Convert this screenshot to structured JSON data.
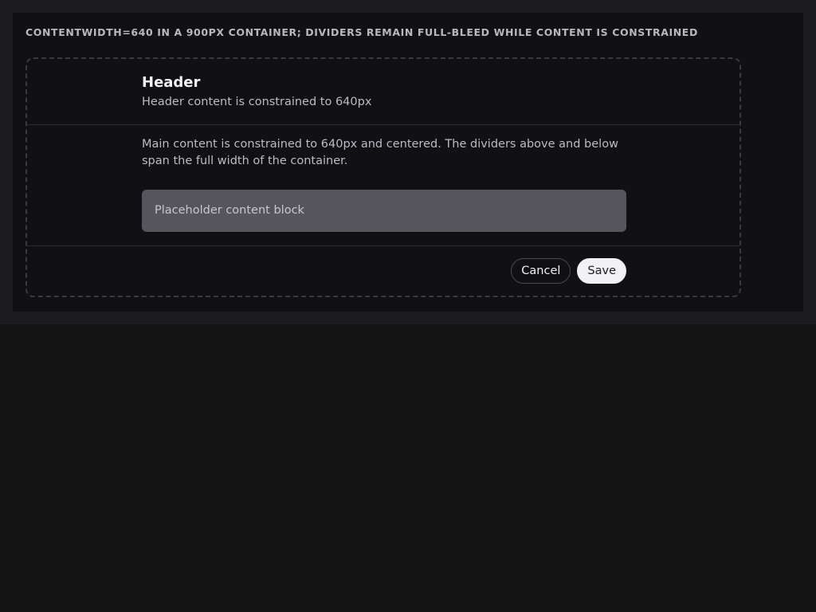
{
  "caption": "CONTENTWIDTH=640 IN A 900PX CONTAINER; DIVIDERS REMAIN FULL-BLEED WHILE CONTENT IS CONSTRAINED",
  "header": {
    "title": "Header",
    "subtitle": "Header content is constrained to 640px"
  },
  "body": {
    "text": "Main content is constrained to 640px and centered. The dividers above and below span the full width of the container.",
    "placeholder_block": "Placeholder content block"
  },
  "footer": {
    "cancel_label": "Cancel",
    "save_label": "Save"
  },
  "colors": {
    "page_background": "#131313",
    "panel_background": "#111014",
    "divider": "#2e2d33",
    "placeholder_fill": "#56555b",
    "primary_button": "#f1f0f4"
  }
}
